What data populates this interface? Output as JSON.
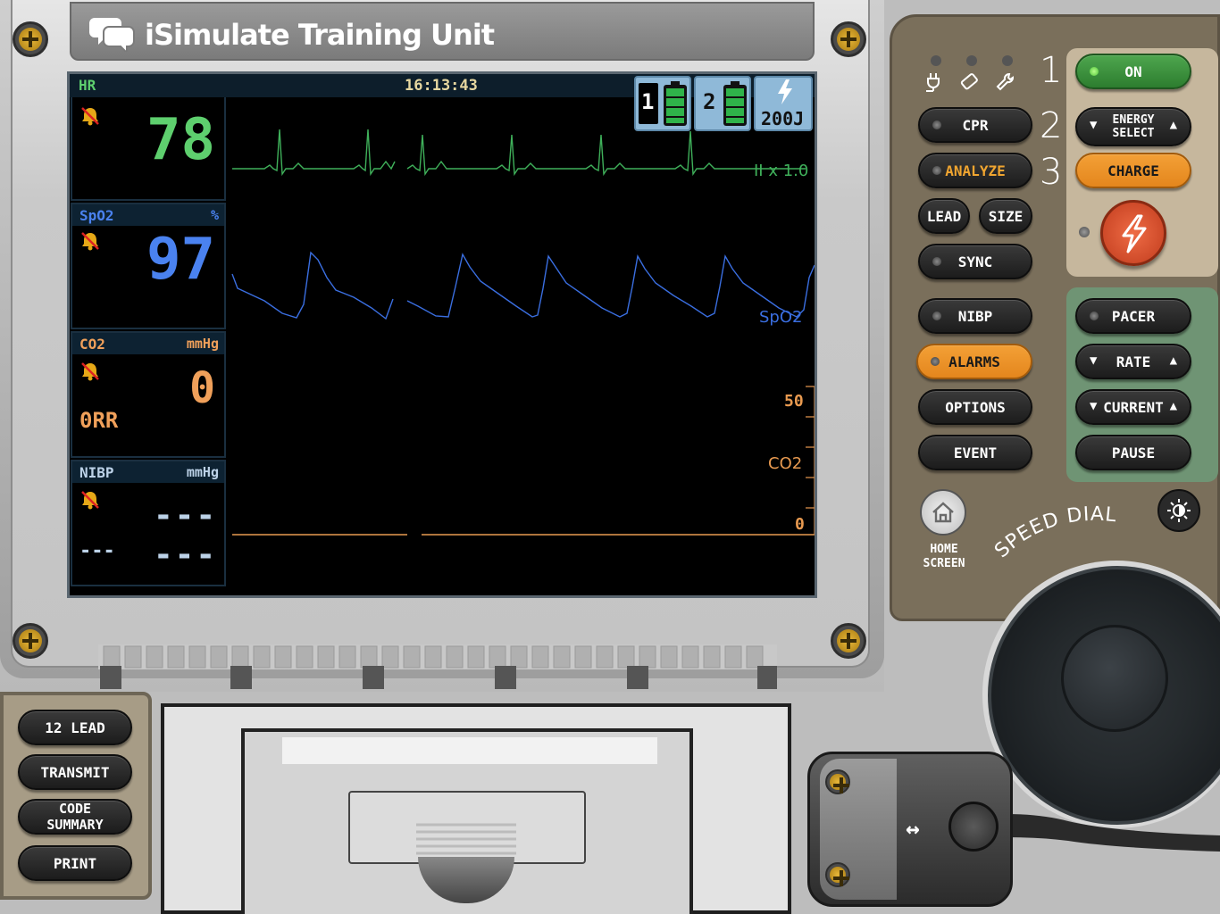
{
  "brand": {
    "title": "iSimulate Training Unit",
    "logo_icon": "speech-bubbles-icon"
  },
  "monitor": {
    "header": {
      "label": "HR",
      "time": "16:13:43"
    },
    "status_tiles": [
      {
        "label": "1",
        "icon": "battery-icon"
      },
      {
        "label": "2",
        "icon": "battery-icon"
      },
      {
        "label": "200J",
        "icon": "lightning-icon"
      }
    ],
    "params": {
      "hr": {
        "value": "78",
        "color": "#5ecf6e"
      },
      "spo2": {
        "name": "SpO2",
        "unit": "%",
        "value": "97",
        "color": "#4a82f0"
      },
      "co2": {
        "name": "CO2",
        "unit": "mmHg",
        "value": "0",
        "rr": "0RR",
        "color": "#f0a05a"
      },
      "nibp": {
        "name": "NIBP",
        "unit": "mmHg",
        "systolic": "---",
        "diastolic": "---",
        "map": "---",
        "color": "#bcd2e8"
      }
    },
    "waveforms": {
      "ecg_label": "II x 1.0",
      "spo2_label": "SpO2",
      "co2_label": "CO2",
      "co2_scale_top": "50",
      "co2_scale_bottom": "0"
    }
  },
  "controls": {
    "indicators": [
      "power-plug-icon",
      "pad-icon",
      "wrench-icon"
    ],
    "numbers": [
      "1",
      "2",
      "3"
    ],
    "on_label": "ON",
    "cpr": "CPR",
    "analyze": "ANALYZE",
    "lead": "LEAD",
    "size": "SIZE",
    "sync": "SYNC",
    "nibp": "NIBP",
    "alarms": "ALARMS",
    "options": "OPTIONS",
    "event": "EVENT",
    "energy_select": "ENERGY\nSELECT",
    "charge": "CHARGE",
    "pacer": "PACER",
    "rate": "RATE",
    "current": "CURRENT",
    "pause": "PAUSE",
    "home": "HOME\nSCREEN",
    "speed_dial": "SPEED DIAL"
  },
  "bottom_buttons": {
    "twelve_lead": "12 LEAD",
    "transmit": "TRANSMIT",
    "code_summary": "CODE\nSUMMARY",
    "print": "PRINT"
  }
}
